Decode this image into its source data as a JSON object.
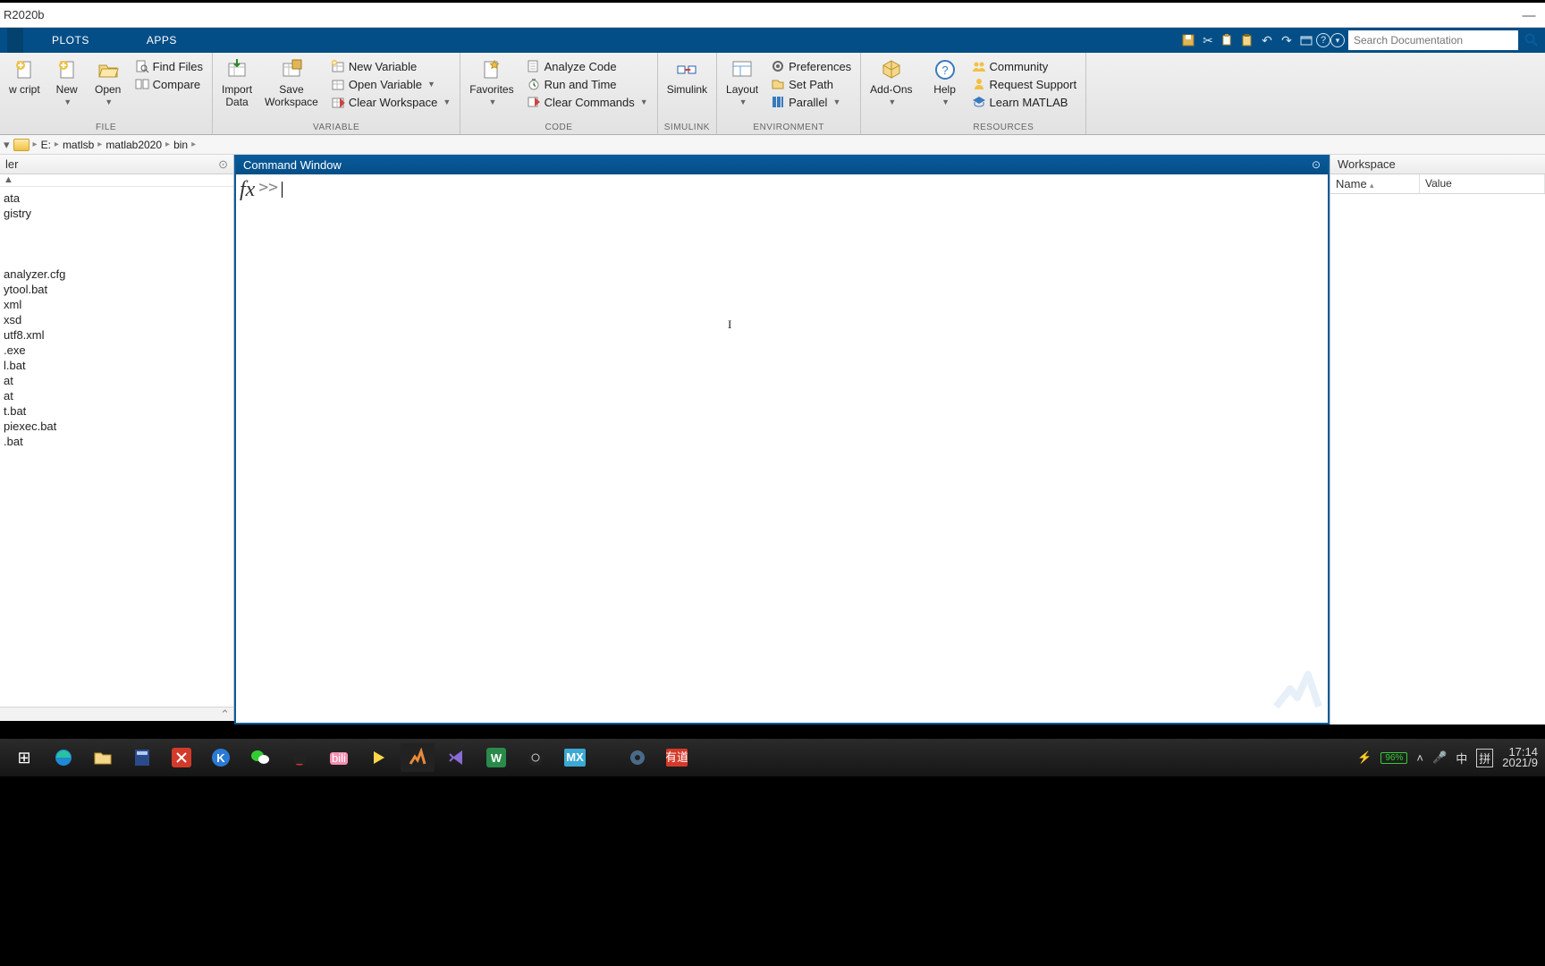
{
  "title": "R2020b",
  "tabs": {
    "plots": "PLOTS",
    "apps": "APPS"
  },
  "search": {
    "placeholder": "Search Documentation"
  },
  "ribbon": {
    "file": {
      "group": "FILE",
      "newscript": "w\ncript",
      "new": "New",
      "open": "Open",
      "findfiles": "Find Files",
      "compare": "Compare"
    },
    "variable": {
      "group": "VARIABLE",
      "importdata": "Import\nData",
      "savews": "Save\nWorkspace",
      "newvar": "New Variable",
      "openvar": "Open Variable",
      "clearws": "Clear Workspace"
    },
    "code": {
      "group": "CODE",
      "favorites": "Favorites",
      "analyze": "Analyze Code",
      "runtime": "Run and Time",
      "clearcmd": "Clear Commands"
    },
    "simulink": {
      "group": "SIMULINK",
      "simulink": "Simulink"
    },
    "environment": {
      "group": "ENVIRONMENT",
      "layout": "Layout",
      "prefs": "Preferences",
      "setpath": "Set Path",
      "parallel": "Parallel"
    },
    "addons": {
      "addons": "Add-Ons"
    },
    "resources": {
      "group": "RESOURCES",
      "help": "Help",
      "community": "Community",
      "support": "Request Support",
      "learn": "Learn MATLAB"
    }
  },
  "path": {
    "drive": "E:",
    "p1": "matlsb",
    "p2": "matlab2020",
    "p3": "bin"
  },
  "left": {
    "title": "ler",
    "items": [
      "ata",
      "gistry",
      "",
      "",
      "",
      "analyzer.cfg",
      "ytool.bat",
      "xml",
      "xsd",
      "utf8.xml",
      ".exe",
      "l.bat",
      "at",
      "at",
      "t.bat",
      "piexec.bat",
      ".bat"
    ]
  },
  "cmd": {
    "title": "Command Window",
    "prompt": ">>"
  },
  "ws": {
    "title": "Workspace",
    "col1": "Name",
    "col2": "Value"
  },
  "tray": {
    "batt": "96%",
    "ime1": "中",
    "ime2": "拼",
    "time": "17:14",
    "date": "2021/9"
  }
}
